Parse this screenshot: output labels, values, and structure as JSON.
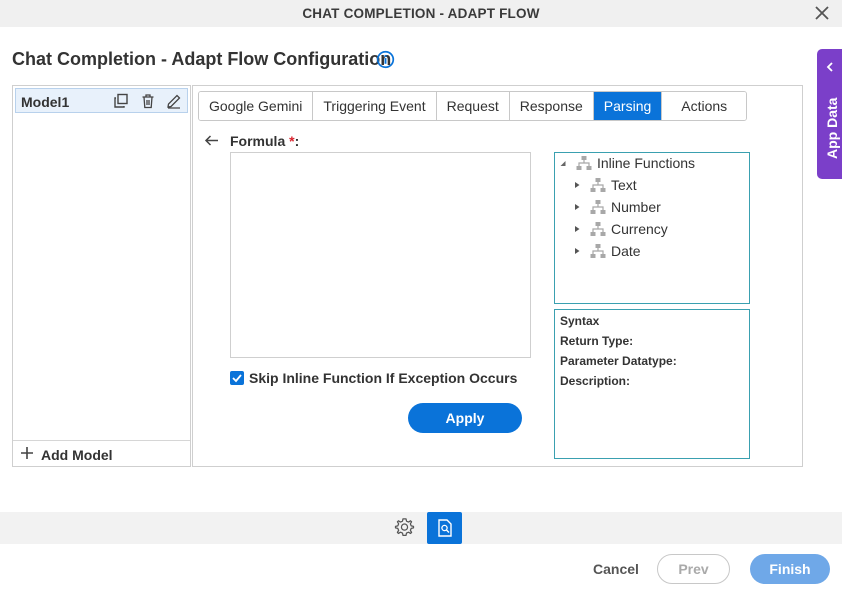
{
  "window": {
    "title": "CHAT COMPLETION - ADAPT FLOW"
  },
  "page": {
    "heading": "Chat Completion - Adapt Flow Configuration"
  },
  "app_data": {
    "label": "App Data"
  },
  "models": {
    "items": [
      {
        "label": "Model1"
      }
    ],
    "add_label": "Add Model"
  },
  "tabs": [
    {
      "label": "Google Gemini",
      "active": false
    },
    {
      "label": "Triggering Event",
      "active": false
    },
    {
      "label": "Request",
      "active": false
    },
    {
      "label": "Response",
      "active": false
    },
    {
      "label": "Parsing",
      "active": true
    },
    {
      "label": "Actions",
      "active": false
    }
  ],
  "formula": {
    "label": "Formula",
    "required_mark": "*",
    "suffix": ":",
    "value": ""
  },
  "skip_inline": {
    "label": "Skip Inline Function If Exception Occurs",
    "checked": true
  },
  "apply_label": "Apply",
  "inline_functions": {
    "root": "Inline Functions",
    "children": [
      {
        "label": "Text"
      },
      {
        "label": "Number"
      },
      {
        "label": "Currency"
      },
      {
        "label": "Date"
      }
    ]
  },
  "syntax": {
    "syntax_label": "Syntax",
    "return_type_label": "Return Type:",
    "parameter_datatype_label": "Parameter Datatype:",
    "description_label": "Description:"
  },
  "footer": {
    "cancel": "Cancel",
    "prev": "Prev",
    "finish": "Finish"
  },
  "colors": {
    "accent": "#0a73d9",
    "app_data_tab": "#7b3fc9",
    "finish_disabled": "#6fa8e8",
    "required": "#d9232d"
  }
}
